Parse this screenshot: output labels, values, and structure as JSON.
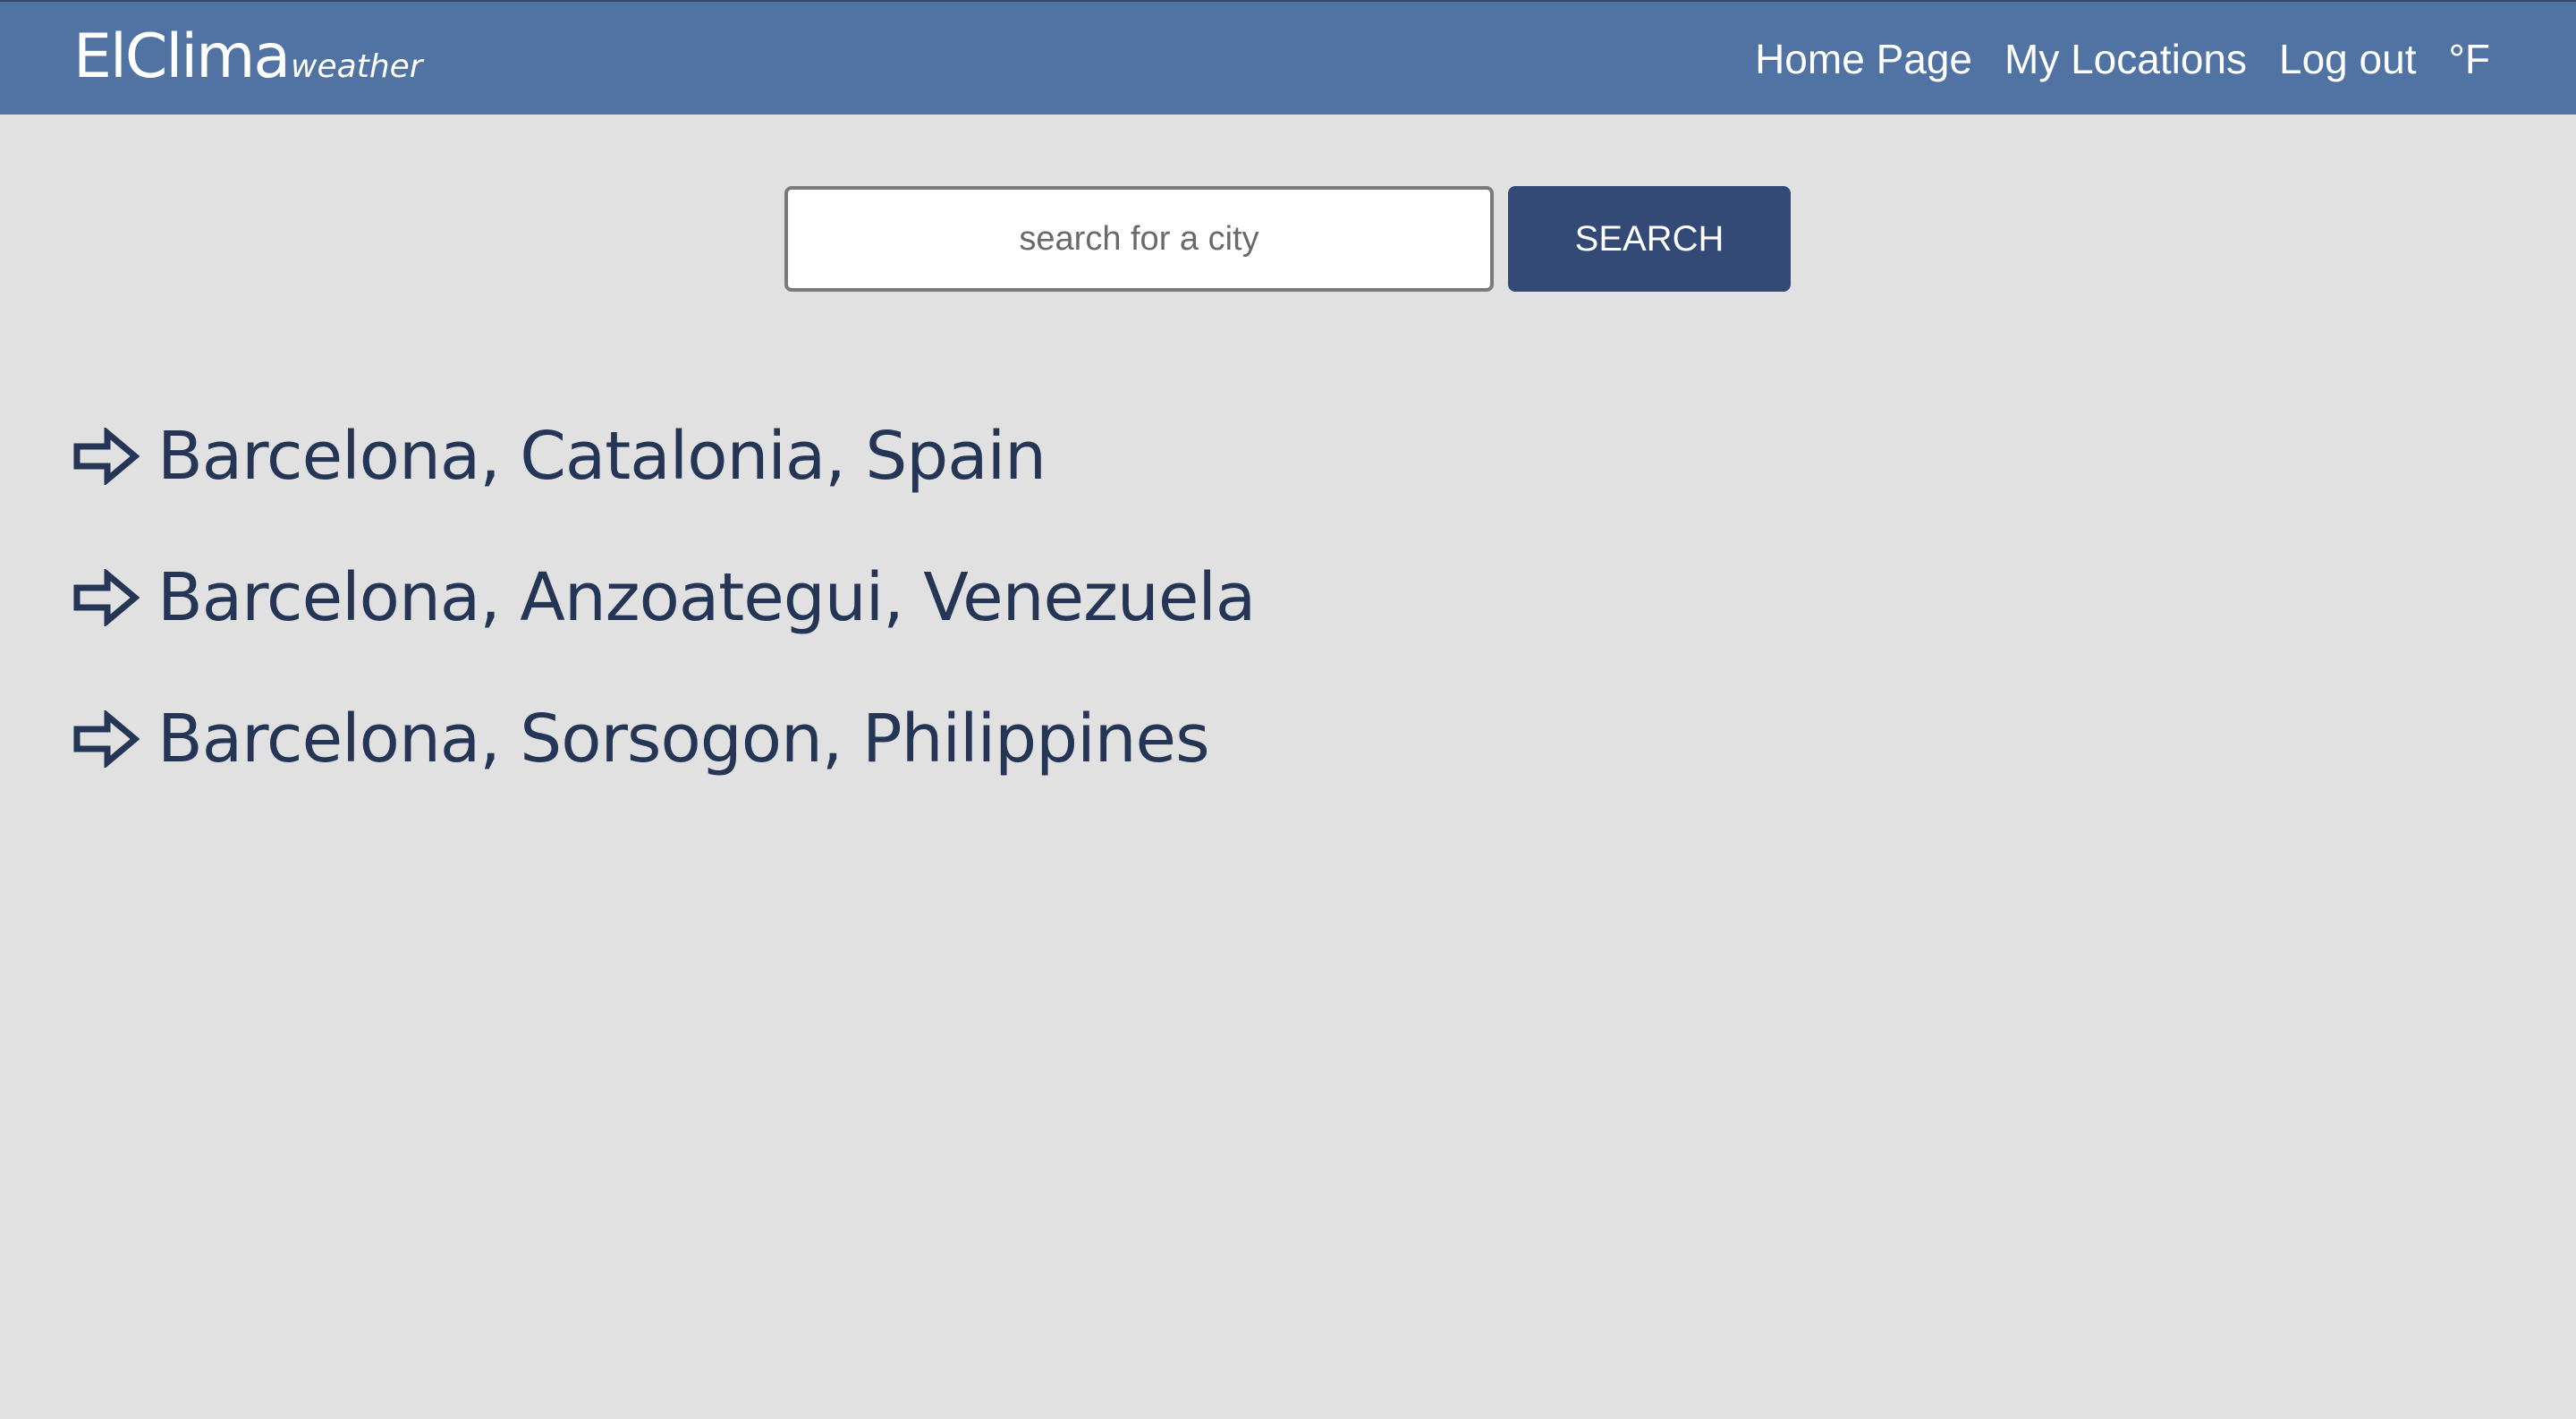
{
  "header": {
    "brand_main": "ElClima",
    "brand_sub": "weather",
    "nav": [
      {
        "label": "Home Page"
      },
      {
        "label": "My Locations"
      },
      {
        "label": "Log out"
      },
      {
        "label": "°F"
      }
    ]
  },
  "search": {
    "placeholder": "search for a city",
    "value": "",
    "button_label": "SEARCH"
  },
  "results": [
    {
      "label": "Barcelona, Catalonia, Spain",
      "icon": "arrow-right-outline-icon"
    },
    {
      "label": "Barcelona, Anzoategui, Venezuela",
      "icon": "arrow-right-outline-icon"
    },
    {
      "label": "Barcelona, Sorsogon, Philippines",
      "icon": "arrow-right-outline-icon"
    }
  ],
  "colors": {
    "navbar": "#5073a4",
    "background": "#e1e1e1",
    "button": "#324a75",
    "result_text": "#243556"
  }
}
